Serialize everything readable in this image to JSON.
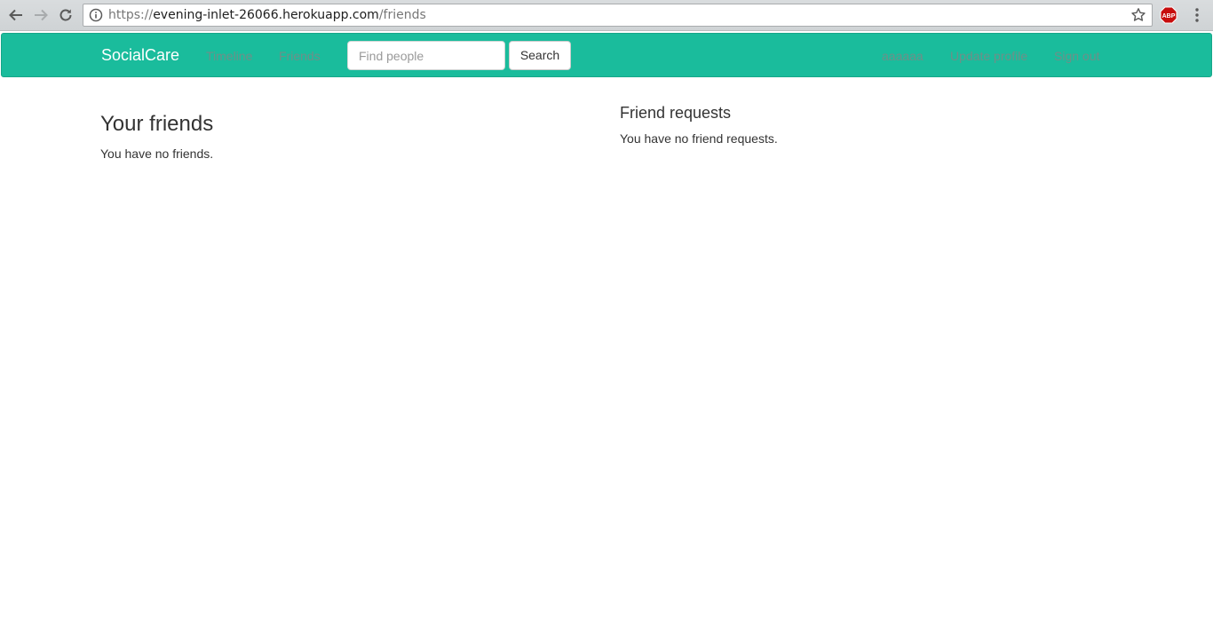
{
  "browser": {
    "url_scheme": "https://",
    "url_host": "evening-inlet-26066.herokuapp.com",
    "url_path": "/friends",
    "extension_badge": "ABP"
  },
  "navbar": {
    "brand": "SocialCare",
    "links": [
      "Timeline",
      "Friends"
    ],
    "search_placeholder": "Find people",
    "search_button": "Search",
    "right_links": [
      "aaaaaa",
      "Update profile",
      "Sign out"
    ]
  },
  "friends": {
    "title": "Your friends",
    "empty_text": "You have no friends."
  },
  "requests": {
    "title": "Friend requests",
    "empty_text": "You have no friend requests."
  },
  "colors": {
    "navbar_bg": "#1abc9c",
    "text": "#333333",
    "muted_link": "#6f8f88"
  }
}
